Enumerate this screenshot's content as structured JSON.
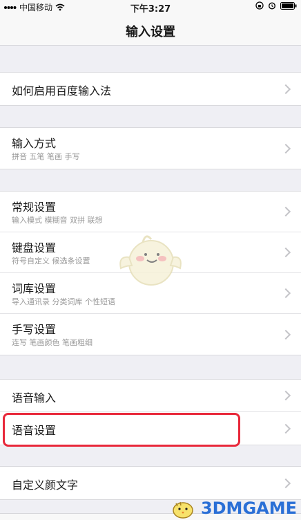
{
  "status_bar": {
    "carrier": "中国移动",
    "time": "下午3:27"
  },
  "nav": {
    "title": "输入设置"
  },
  "groups": [
    {
      "rows": [
        {
          "title": "如何启用百度输入法"
        }
      ]
    },
    {
      "rows": [
        {
          "title": "输入方式",
          "subtitle": "拼音 五笔 笔画 手写"
        }
      ]
    },
    {
      "rows": [
        {
          "title": "常规设置",
          "subtitle": "输入模式 模糊音 双拼 联想"
        },
        {
          "title": "键盘设置",
          "subtitle": "符号自定义 候选条设置"
        },
        {
          "title": "词库设置",
          "subtitle": "导入通讯录 分类词库 个性短语"
        },
        {
          "title": "手写设置",
          "subtitle": "连写 笔画颜色 笔画粗细"
        }
      ]
    },
    {
      "rows": [
        {
          "title": "语音输入"
        },
        {
          "title": "语音设置"
        }
      ]
    },
    {
      "rows": [
        {
          "title": "自定义颜文字"
        }
      ]
    }
  ],
  "watermark": {
    "text": "3DMGAME"
  },
  "colors": {
    "highlight": "#e8283a",
    "watermark": "#2a6fd6"
  }
}
